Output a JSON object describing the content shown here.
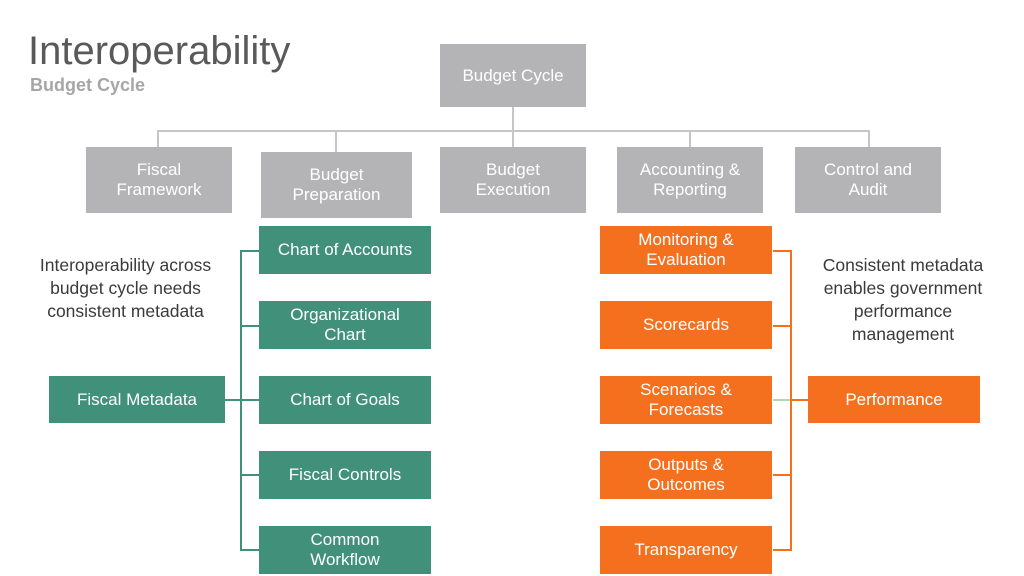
{
  "header": {
    "title": "Interoperability",
    "subtitle": "Budget Cycle"
  },
  "colors": {
    "gray": "#b4b4b6",
    "green": "#40907a",
    "orange": "#f4701f",
    "line_gray": "#c6c6c6",
    "light_green": "#b5d6b0",
    "title_text": "#595959",
    "subtitle_text": "#a6a6a6",
    "note_text": "#3a3a3a"
  },
  "root": {
    "label": "Budget Cycle"
  },
  "phases": [
    {
      "label": "Fiscal\nFramework"
    },
    {
      "label": "Budget\nPreparation"
    },
    {
      "label": "Budget\nExecution"
    },
    {
      "label": "Accounting &\nReporting"
    },
    {
      "label": "Control and\nAudit"
    }
  ],
  "green_branch": {
    "hub_label": "Fiscal Metadata",
    "note": "Interoperability across\nbudget cycle needs\nconsistent metadata",
    "items": [
      {
        "label": "Chart of Accounts"
      },
      {
        "label": "Organizational\nChart"
      },
      {
        "label": "Chart of Goals"
      },
      {
        "label": "Fiscal Controls"
      },
      {
        "label": "Common\nWorkflow"
      }
    ]
  },
  "orange_branch": {
    "hub_label": "Performance",
    "note": "Consistent metadata\nenables government\nperformance\nmanagement",
    "items": [
      {
        "label": "Monitoring &\nEvaluation"
      },
      {
        "label": "Scorecards"
      },
      {
        "label": "Scenarios &\nForecasts"
      },
      {
        "label": "Outputs &\nOutcomes"
      },
      {
        "label": "Transparency"
      }
    ]
  }
}
